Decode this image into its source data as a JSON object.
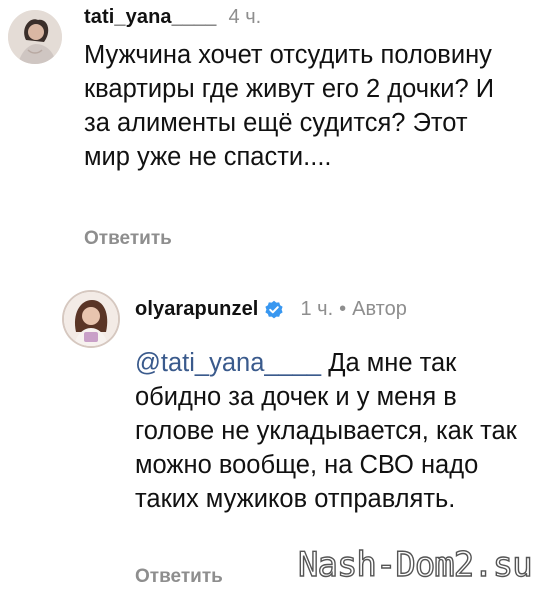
{
  "comments": [
    {
      "username": "tati_yana____",
      "time": "4 ч.",
      "text": "Мужчина хочет отсудить половину квартиры где живут его 2 дочки? И за алименты ещё судится? Этот мир уже не спасти....",
      "reply_label": "Ответить"
    },
    {
      "username": "olyarapunzel",
      "verified": true,
      "time": "1 ч.",
      "separator": "•",
      "author_label": "Автор",
      "mention": "@tati_yana____",
      "text": " Да мне так обидно за дочек и у меня в голове не укладывается, как так можно вообще, на СВО надо таких мужиков отправлять.",
      "reply_label": "Ответить"
    }
  ],
  "watermark": "Nash-Dom2.su",
  "colors": {
    "text": "#111111",
    "secondary": "#8e8e8e",
    "mention": "#3a5a8c",
    "verified": "#3897f0"
  },
  "icons": {
    "verified": "verified-badge-icon"
  }
}
